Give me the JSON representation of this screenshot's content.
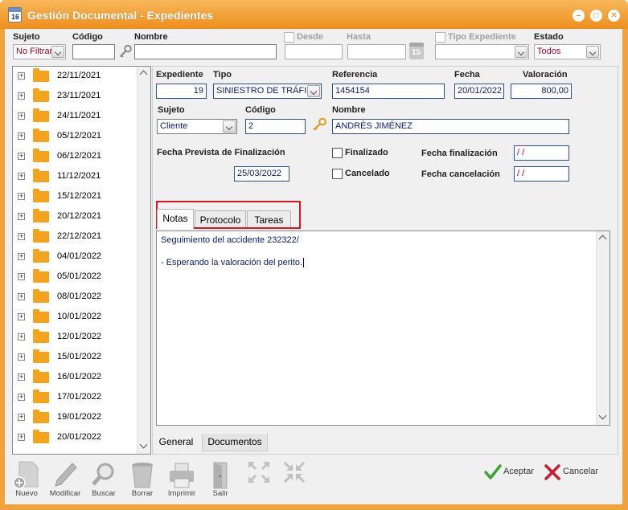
{
  "window": {
    "title": "Gestión Documental - Expedientes",
    "icon_text": "16",
    "controls": [
      "minimize-icon",
      "maximize-icon",
      "close-icon"
    ],
    "accent": "#ee8e1c"
  },
  "filters": {
    "sujeto_label": "Sujeto",
    "sujeto_value": "No Filtrar",
    "codigo_label": "Código",
    "codigo_value": "",
    "nombre_label": "Nombre",
    "nombre_value": "",
    "desde_label": "Desde",
    "desde_value": "",
    "hasta_label": "Hasta",
    "hasta_value": "",
    "calendar_text": "15",
    "tipo_expediente_label": "Tipo Expediente",
    "tipo_expediente_value": "",
    "estado_label": "Estado",
    "estado_value": "Todos"
  },
  "tree": {
    "items": [
      {
        "label": "22/11/2021"
      },
      {
        "label": "23/11/2021"
      },
      {
        "label": "24/11/2021"
      },
      {
        "label": "05/12/2021"
      },
      {
        "label": "06/12/2021"
      },
      {
        "label": "11/12/2021"
      },
      {
        "label": "15/12/2021"
      },
      {
        "label": "20/12/2021"
      },
      {
        "label": "22/12/2021"
      },
      {
        "label": "04/01/2022"
      },
      {
        "label": "05/01/2022"
      },
      {
        "label": "08/01/2022"
      },
      {
        "label": "10/01/2022"
      },
      {
        "label": "12/01/2022"
      },
      {
        "label": "15/01/2022"
      },
      {
        "label": "16/01/2022"
      },
      {
        "label": "17/01/2022"
      },
      {
        "label": "19/01/2022"
      },
      {
        "label": "20/01/2022"
      }
    ]
  },
  "detail": {
    "expediente_label": "Expediente",
    "expediente_value": "19",
    "tipo_label": "Tipo",
    "tipo_value": "SINIESTRO DE TRÁFICO",
    "referencia_label": "Referencia",
    "referencia_value": "1454154",
    "fecha_label": "Fecha",
    "fecha_value": "20/01/2022",
    "valoracion_label": "Valoración",
    "valoracion_value": "800,00",
    "sujeto_label": "Sujeto",
    "sujeto_value": "Cliente",
    "codigo_label": "Código",
    "codigo_value": "2",
    "nombre_label": "Nombre",
    "nombre_value": "ANDRÉS JIMÉNEZ",
    "fecha_prevista_label": "Fecha Prevista de Finalización",
    "fecha_prevista_value": "25/03/2022",
    "finalizado_label": "Finalizado",
    "cancelado_label": "Cancelado",
    "fecha_finalizacion_label": "Fecha finalización",
    "fecha_finalizacion_value": " /  /",
    "fecha_cancelacion_label": "Fecha cancelación",
    "fecha_cancelacion_value": " /  /"
  },
  "tabs": [
    {
      "label": "Notas"
    },
    {
      "label": "Protocolo"
    },
    {
      "label": "Tareas"
    }
  ],
  "notes": {
    "line1": "Seguimiento del accidente 232322/",
    "line2": "",
    "line3": "- Esperando la valoración del perito."
  },
  "bottom_tabs": [
    {
      "label": "General"
    },
    {
      "label": "Documentos"
    }
  ],
  "toolbar": {
    "nuevo": "Nuevo",
    "modificar": "Modificar",
    "buscar": "Buscar",
    "borrar": "Borrar",
    "imprimir": "Imprimir",
    "salir": "Salir"
  },
  "actions": {
    "aceptar": "Aceptar",
    "cancelar": "Cancelar"
  }
}
